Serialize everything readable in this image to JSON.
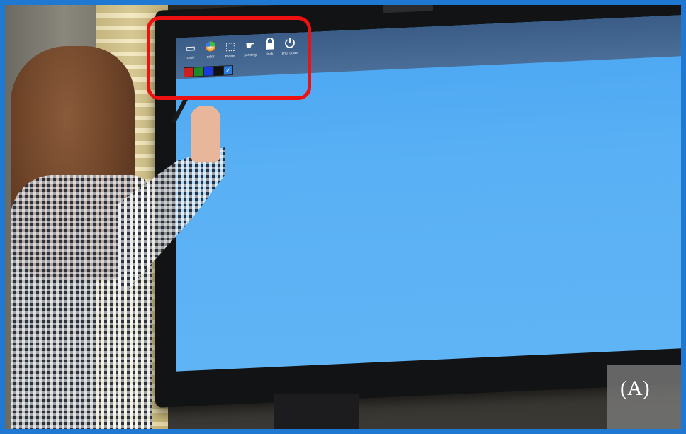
{
  "scene": {
    "panel_label": "(A)",
    "highlight_color": "#ee1111",
    "border_color": "#1f78d1",
    "screen_color": "#5fb4f5"
  },
  "toolbar": {
    "tools": [
      {
        "icon": "rectangle-icon",
        "label": "clear"
      },
      {
        "icon": "color-wheel-icon",
        "label": "color"
      },
      {
        "icon": "eraser-icon",
        "label": "eraser"
      },
      {
        "icon": "pointing-hand-icon",
        "label": "pointing"
      },
      {
        "icon": "lock-icon",
        "label": "lock"
      },
      {
        "icon": "power-icon",
        "label": "shut down"
      }
    ],
    "swatches": [
      "#cc1f1f",
      "#1d8a2a",
      "#1a3ae0",
      "#111111",
      "#2a7de0"
    ]
  }
}
